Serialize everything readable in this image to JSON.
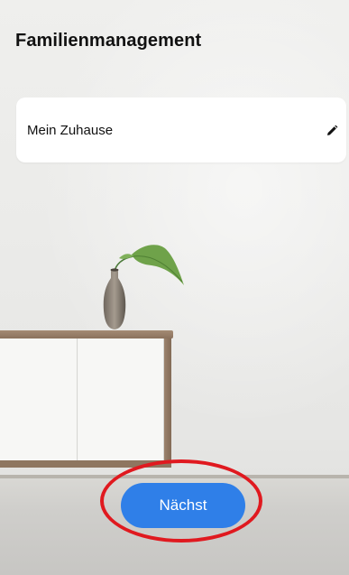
{
  "header": {
    "title": "Familienmanagement"
  },
  "home_card": {
    "label": "Mein Zuhause",
    "edit_icon": "pencil-icon"
  },
  "footer": {
    "next_label": "Nächst"
  },
  "colors": {
    "accent": "#2f7fe8",
    "highlight": "#e0191f",
    "text": "#111111",
    "card": "#ffffff"
  }
}
